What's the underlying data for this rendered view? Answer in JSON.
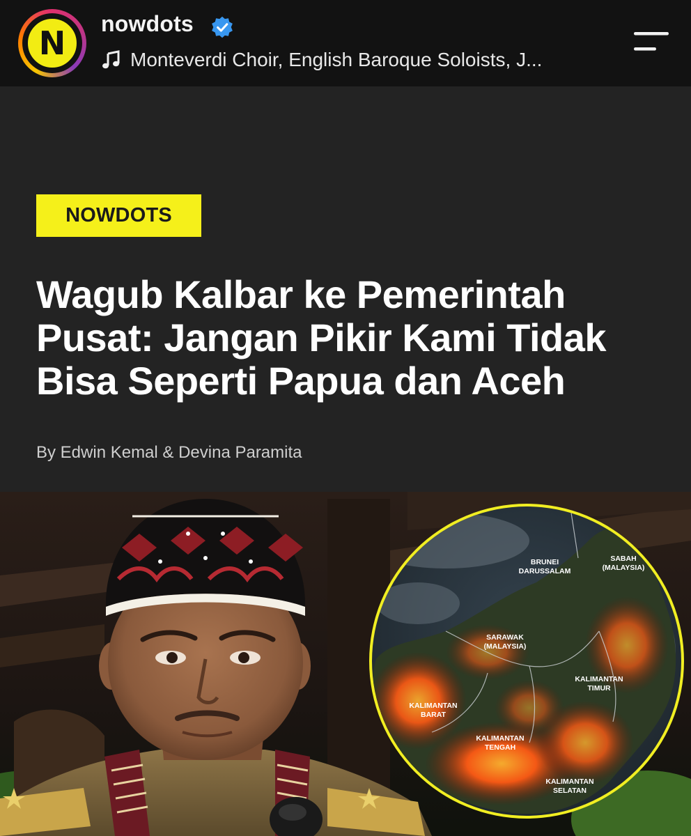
{
  "header": {
    "account_name": "nowdots",
    "avatar_letter": "N",
    "music_track": "Monteverdi Choir, English Baroque Soloists, J...",
    "icons": {
      "verified": "verified-badge-icon",
      "music": "music-note-icon",
      "menu": "menu-icon"
    }
  },
  "article": {
    "category": "NOWDOTS",
    "headline_lines": [
      "Wagub Kalbar ke Pemerintah",
      "Pusat: Jangan Pikir Kami Tidak",
      "Bisa Seperti Papua dan Aceh"
    ],
    "byline": "By Edwin Kemal & Devina Paramita"
  },
  "map": {
    "labels": {
      "brunei_1": "BRUNEI",
      "brunei_2": "DARUSSALAM",
      "sabah_1": "SABAH",
      "sabah_2": "(MALAYSIA)",
      "sarawak_1": "SARAWAK",
      "sarawak_2": "(MALAYSIA)",
      "timur_1": "KALIMANTAN",
      "timur_2": "TIMUR",
      "barat_1": "KALIMANTAN",
      "barat_2": "BARAT",
      "tengah_1": "KALIMANTAN",
      "tengah_2": "TENGAH",
      "selatan_1": "KALIMANTAN",
      "selatan_2": "SELATAN"
    }
  },
  "colors": {
    "badge_bg": "#f5f01a",
    "hero_bg": "#232323",
    "topbar_bg": "#121212",
    "verified_blue": "#3897f0",
    "map_ring": "#f1ee22",
    "fire": "#ff5a14"
  }
}
